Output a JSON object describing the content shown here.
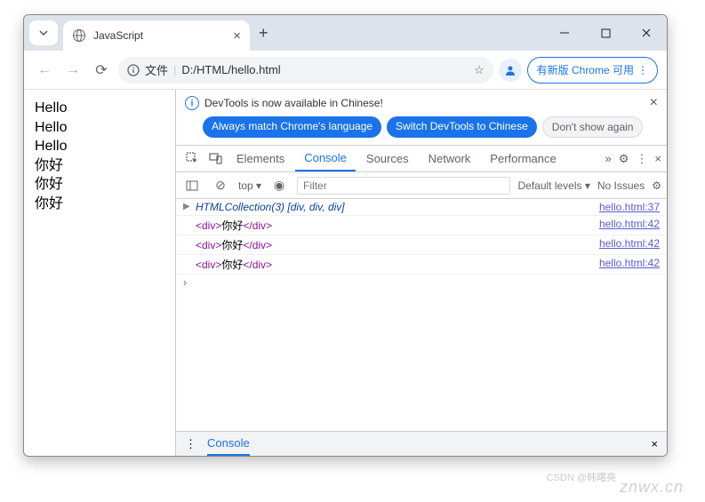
{
  "window": {
    "tab_title": "JavaScript",
    "minimize": "—",
    "maximize": "□",
    "close": "✕"
  },
  "addressbar": {
    "file_label": "文件",
    "url": "D:/HTML/hello.html",
    "update_pill": "有新版 Chrome 可用"
  },
  "page_lines": [
    "Hello",
    "Hello",
    "Hello",
    "你好",
    "你好",
    "你好"
  ],
  "devtools": {
    "banner_text": "DevTools is now available in Chinese!",
    "pills": {
      "match": "Always match Chrome's language",
      "switch": "Switch DevTools to Chinese",
      "dismiss": "Don't show again"
    },
    "tabs": {
      "elements": "Elements",
      "console": "Console",
      "sources": "Sources",
      "network": "Network",
      "performance": "Performance"
    },
    "filter": {
      "top": "top",
      "placeholder": "Filter",
      "levels": "Default levels",
      "issues": "No Issues"
    },
    "logs": [
      {
        "kind": "collection",
        "text_prefix": "HTMLCollection(3)",
        "bracket": " [",
        "items": "div, div, div",
        "close": "]",
        "src": "hello.html:37"
      },
      {
        "kind": "div",
        "open": "<div>",
        "content": "你好",
        "close": "</div>",
        "src": "hello.html:42"
      },
      {
        "kind": "div",
        "open": "<div>",
        "content": "你好",
        "close": "</div>",
        "src": "hello.html:42"
      },
      {
        "kind": "div",
        "open": "<div>",
        "content": "你好",
        "close": "</div>",
        "src": "hello.html:42"
      }
    ],
    "drawer_tab": "Console"
  },
  "watermark": "znwx.cn",
  "attribution": "CSDN @韩曙亮"
}
